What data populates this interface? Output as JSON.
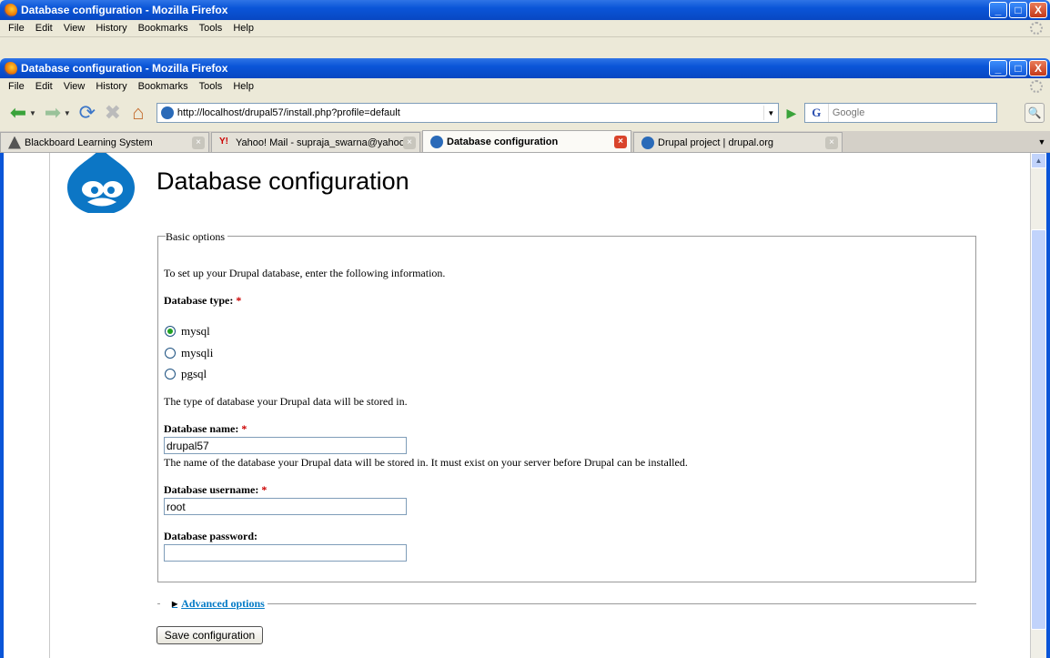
{
  "window": {
    "outer_title": "Database configuration - Mozilla Firefox",
    "inner_title": "Database configuration - Mozilla Firefox",
    "minimize": "_",
    "maximize": "□",
    "close": "X"
  },
  "menu": [
    "File",
    "Edit",
    "View",
    "History",
    "Bookmarks",
    "Tools",
    "Help"
  ],
  "nav": {
    "url": "http://localhost/drupal57/install.php?profile=default",
    "search_placeholder": "Google",
    "search_engine_letter": "G"
  },
  "tabs": [
    {
      "label": "Blackboard Learning System",
      "active": false,
      "icon": "blackboard-icon"
    },
    {
      "label": "Yahoo! Mail - supraja_swarna@yahoo....",
      "active": false,
      "icon": "yahoo-icon"
    },
    {
      "label": "Database configuration",
      "active": true,
      "icon": "drupal-icon"
    },
    {
      "label": "Drupal project | drupal.org",
      "active": false,
      "icon": "drupal-icon"
    }
  ],
  "page": {
    "title": "Database configuration",
    "fieldset_legend": "Basic options",
    "intro": "To set up your Drupal database, enter the following information.",
    "db_type_label": "Database type:",
    "required_mark": "*",
    "db_types": [
      "mysql",
      "mysqli",
      "pgsql"
    ],
    "db_type_selected": "mysql",
    "db_type_desc": "The type of database your Drupal data will be stored in.",
    "db_name_label": "Database name:",
    "db_name_value": "drupal57",
    "db_name_desc": "The name of the database your Drupal data will be stored in. It must exist on your server before Drupal can be installed.",
    "db_user_label": "Database username:",
    "db_user_value": "root",
    "db_pass_label": "Database password:",
    "db_pass_value": "",
    "advanced_label": "Advanced options",
    "save_label": "Save configuration"
  }
}
